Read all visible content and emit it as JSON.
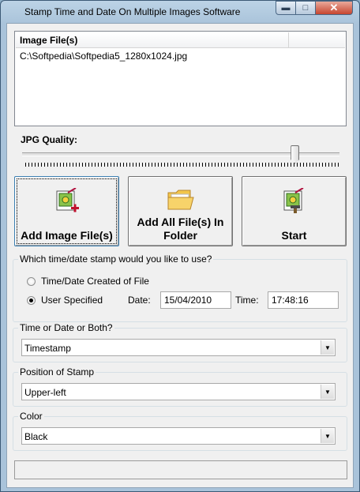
{
  "window": {
    "title": "Stamp Time and Date On Multiple Images Software",
    "min_glyph": "▬",
    "max_glyph": "□",
    "close_glyph": "✕"
  },
  "files": {
    "header": "Image File(s)",
    "rows": [
      "C:\\Softpedia\\Softpedia5_1280x1024.jpg"
    ]
  },
  "quality": {
    "label": "JPG Quality:",
    "value_fraction": 0.86
  },
  "buttons": {
    "add_files": "Add Image File(s)",
    "add_folder": "Add All File(s) In Folder",
    "start": "Start"
  },
  "stamp_group": {
    "legend": "Which time/date stamp would you like to use?",
    "option_created": "Time/Date Created of File",
    "option_user": "User Specified",
    "selected": "User Specified",
    "date_label": "Date:",
    "date_value": "15/04/2010",
    "time_label": "Time:",
    "time_value": "17:48:16"
  },
  "time_or_date": {
    "legend": "Time or Date or Both?",
    "value": "Timestamp"
  },
  "position": {
    "legend": "Position of Stamp",
    "value": "Upper-left"
  },
  "color": {
    "legend": "Color",
    "value": "Black"
  },
  "status": {
    "text": ""
  }
}
